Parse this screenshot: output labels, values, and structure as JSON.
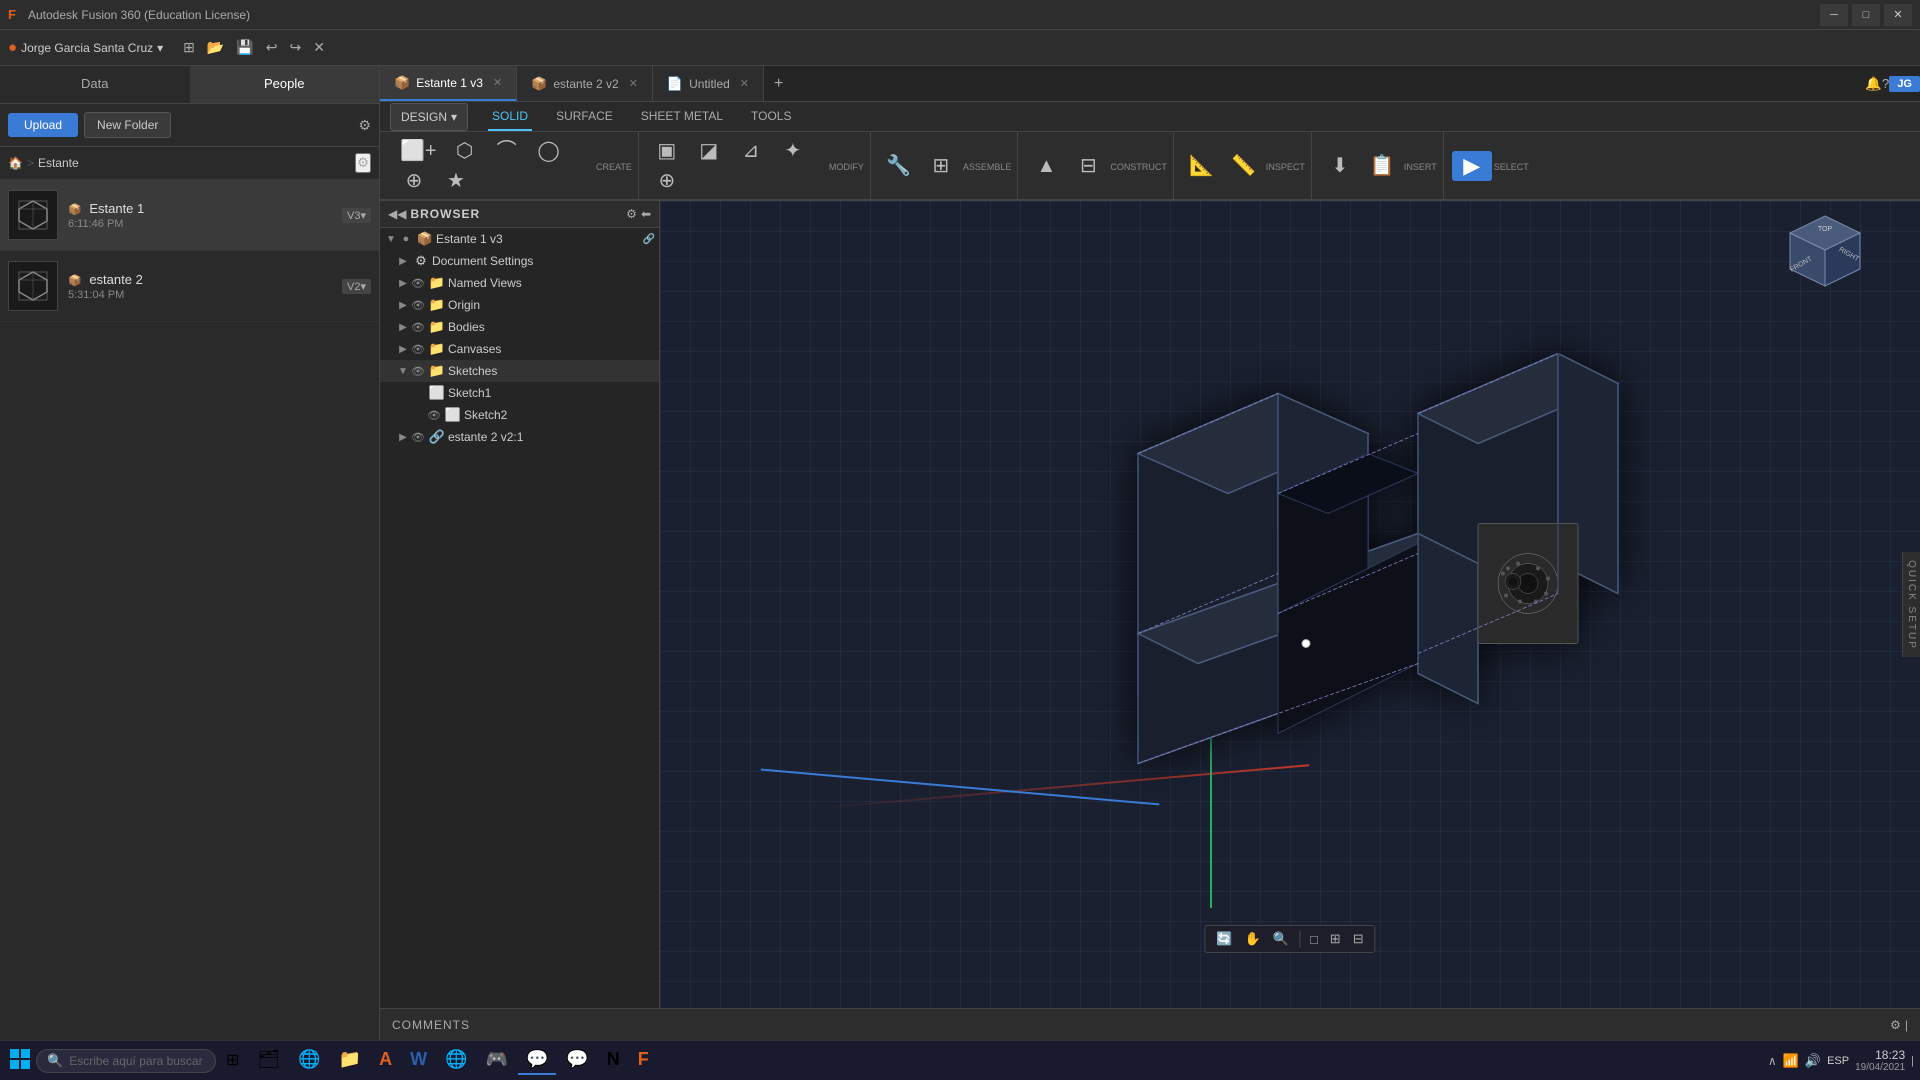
{
  "app": {
    "title": "Autodesk Fusion 360 (Education License)",
    "logo": "F"
  },
  "window_controls": {
    "minimize": "─",
    "maximize": "□",
    "close": "✕"
  },
  "user": {
    "name": "Jorge Garcia Santa Cruz",
    "chevron": "▾"
  },
  "menu_icons": [
    "⊞",
    "↺",
    "⟳",
    "✕"
  ],
  "panel": {
    "tab_data": "Data",
    "tab_people": "People",
    "upload_label": "Upload",
    "new_folder_label": "New Folder",
    "breadcrumb_home": "🏠",
    "breadcrumb_sep": ">",
    "breadcrumb_current": "Estante",
    "files": [
      {
        "name": "Estante 1",
        "time": "6:11:46 PM",
        "version": "V3▾",
        "icon": "📦"
      },
      {
        "name": "estante 2",
        "time": "5:31:04 PM",
        "version": "V2▾",
        "icon": "📦"
      }
    ]
  },
  "doc_tabs": [
    {
      "label": "Estante 1 v3",
      "icon": "📦",
      "active": true
    },
    {
      "label": "estante 2 v2",
      "icon": "📦",
      "active": false
    },
    {
      "label": "Untitled",
      "icon": "📄",
      "active": false
    }
  ],
  "tool_tabs": {
    "active": "SOLID",
    "tabs": [
      "SOLID",
      "SURFACE",
      "SHEET METAL",
      "TOOLS"
    ]
  },
  "toolbar": {
    "design_label": "DESIGN",
    "groups": [
      {
        "label": "CREATE",
        "tools": [
          "□+",
          "⬡",
          "⌒",
          "◯",
          "⊕",
          "★"
        ]
      },
      {
        "label": "MODIFY",
        "tools": [
          "▣",
          "◪",
          "⊿",
          "✦",
          "⊕"
        ]
      },
      {
        "label": "ASSEMBLE",
        "tools": [
          "🔧",
          "⊞"
        ]
      },
      {
        "label": "CONSTRUCT",
        "tools": [
          "▲",
          "⊟"
        ]
      },
      {
        "label": "INSPECT",
        "tools": [
          "📐",
          "📏"
        ]
      },
      {
        "label": "INSERT",
        "tools": [
          "⬇",
          "📋"
        ]
      },
      {
        "label": "SELECT",
        "tools": [
          "▶"
        ]
      }
    ]
  },
  "browser": {
    "title": "BROWSER",
    "tree": [
      {
        "label": "Estante 1 v3",
        "level": 0,
        "icon": "📦",
        "expanded": true,
        "has_eye": true
      },
      {
        "label": "Document Settings",
        "level": 1,
        "icon": "⚙",
        "expanded": false,
        "has_eye": false
      },
      {
        "label": "Named Views",
        "level": 1,
        "icon": "📁",
        "expanded": false,
        "has_eye": true
      },
      {
        "label": "Origin",
        "level": 1,
        "icon": "📁",
        "expanded": false,
        "has_eye": true
      },
      {
        "label": "Bodies",
        "level": 1,
        "icon": "📁",
        "expanded": false,
        "has_eye": true
      },
      {
        "label": "Canvases",
        "level": 1,
        "icon": "📁",
        "expanded": false,
        "has_eye": true
      },
      {
        "label": "Sketches",
        "level": 1,
        "icon": "📁",
        "expanded": true,
        "has_eye": true
      },
      {
        "label": "Sketch1",
        "level": 2,
        "icon": "📐",
        "expanded": false,
        "has_eye": false
      },
      {
        "label": "Sketch2",
        "level": 2,
        "icon": "📐",
        "expanded": false,
        "has_eye": true
      },
      {
        "label": "estante 2 v2:1",
        "level": 1,
        "icon": "🔗",
        "expanded": false,
        "has_eye": true
      }
    ]
  },
  "comments": {
    "label": "COMMENTS"
  },
  "timeline": {
    "controls": [
      "⏮",
      "◀",
      "▶",
      "▶▶",
      "⏭"
    ]
  },
  "viewport": {
    "quick_setup": "QUICK SETUP"
  },
  "taskbar": {
    "search_placeholder": "Escribe aquí para buscar",
    "apps": [
      "⊞",
      "🗂",
      "🔔",
      "📁",
      "🅰",
      "W",
      "🌐",
      "🎮",
      "🎵",
      "💬",
      "🛡",
      "F"
    ],
    "time": "18:23",
    "date": "19/04/2021",
    "language": "ESP"
  }
}
